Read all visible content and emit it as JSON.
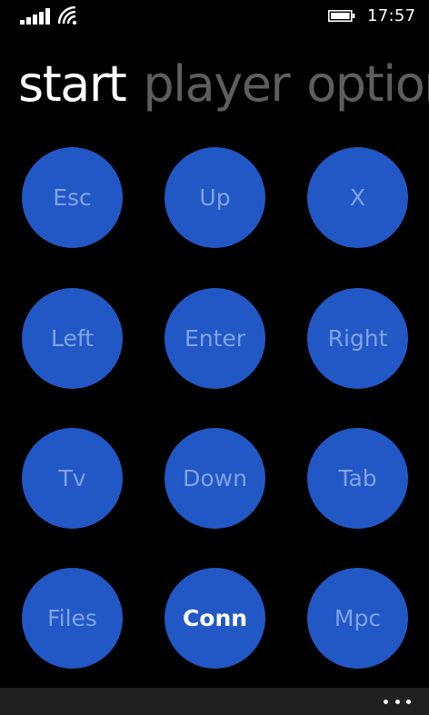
{
  "status_bar": {
    "time": "17:57",
    "signal_icon": "signal-bars-icon",
    "wifi_icon": "wifi-icon",
    "battery_icon": "battery-icon"
  },
  "pivot": {
    "items": [
      {
        "label": "start",
        "active": true
      },
      {
        "label": "player",
        "active": false
      },
      {
        "label": "options",
        "active": false
      }
    ]
  },
  "buttons": [
    {
      "label": "Esc"
    },
    {
      "label": "Up"
    },
    {
      "label": "X"
    },
    {
      "label": "Left"
    },
    {
      "label": "Enter"
    },
    {
      "label": "Right"
    },
    {
      "label": "Tv"
    },
    {
      "label": "Down"
    },
    {
      "label": "Tab"
    },
    {
      "label": "Files"
    },
    {
      "label": "Conn"
    },
    {
      "label": "Mpc"
    }
  ],
  "app_bar": {
    "more_icon": "more-ellipsis-icon"
  },
  "colors": {
    "background": "#000000",
    "button_fill": "#2158c6",
    "button_text": "#7fa3e6",
    "button_text_highlight": "#ffffff",
    "pivot_inactive": "#5e5e5e",
    "app_bar": "#202020"
  }
}
